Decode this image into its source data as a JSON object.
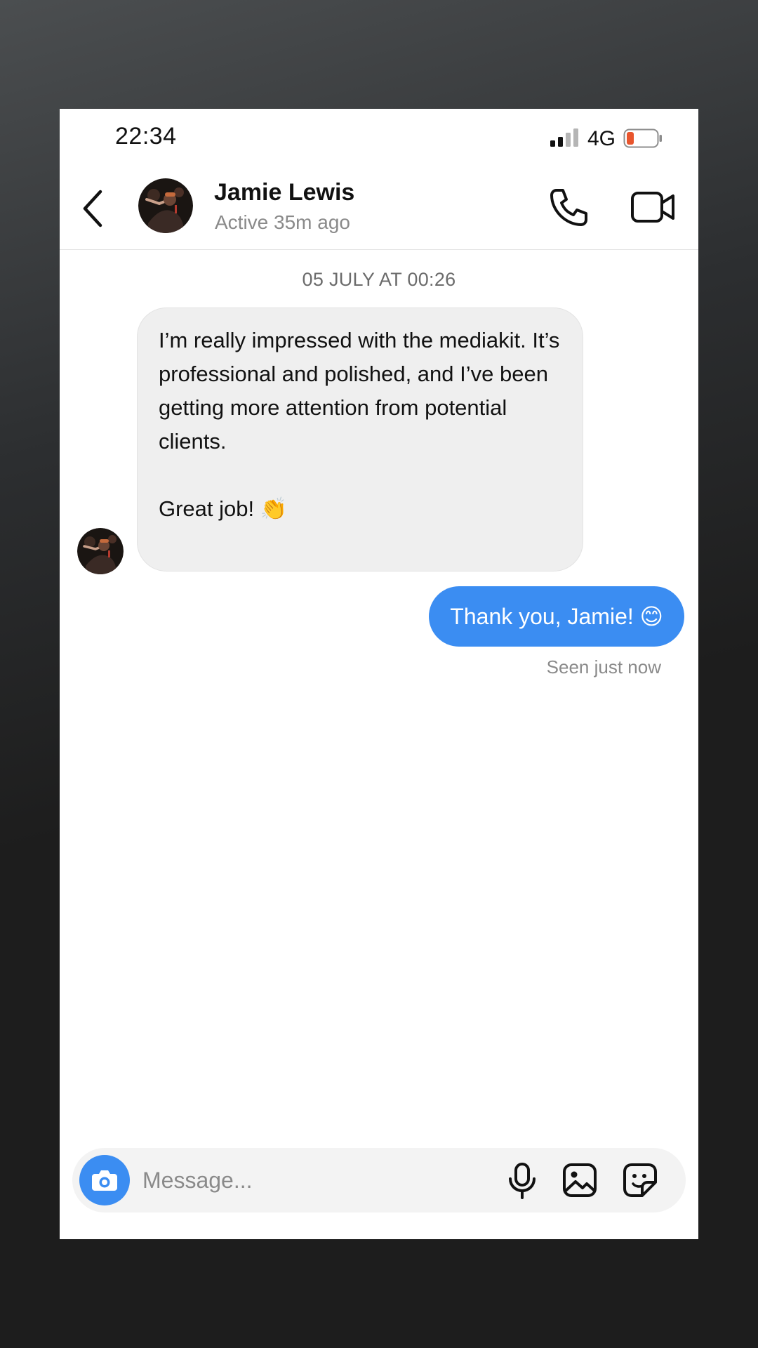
{
  "status_bar": {
    "time": "22:34",
    "network": "4G",
    "icons": [
      "signal-icon",
      "battery-icon"
    ],
    "battery_color": "#e8552d"
  },
  "header": {
    "contact_name": "Jamie Lewis",
    "contact_status": "Active 35m ago",
    "icons": [
      "back-chevron-icon",
      "phone-icon",
      "video-camera-icon"
    ]
  },
  "conversation": {
    "date_divider": "05 JULY AT 00:26",
    "incoming_message": {
      "text": "I’m really impressed with the mediakit. It’s professional and polished, and I’ve been getting more attention from potential clients.",
      "sign_off": "Great job! 👏"
    },
    "outgoing_message": {
      "text": "Thank you, Jamie! 😊"
    },
    "seen_status": "Seen just now"
  },
  "composer": {
    "placeholder": "Message...",
    "icons": [
      "camera-icon",
      "microphone-icon",
      "gallery-icon",
      "sticker-icon"
    ]
  },
  "colors": {
    "accent": "#3b8df2",
    "incoming_bubble": "#efefef",
    "muted_text": "#8a8a8a"
  }
}
